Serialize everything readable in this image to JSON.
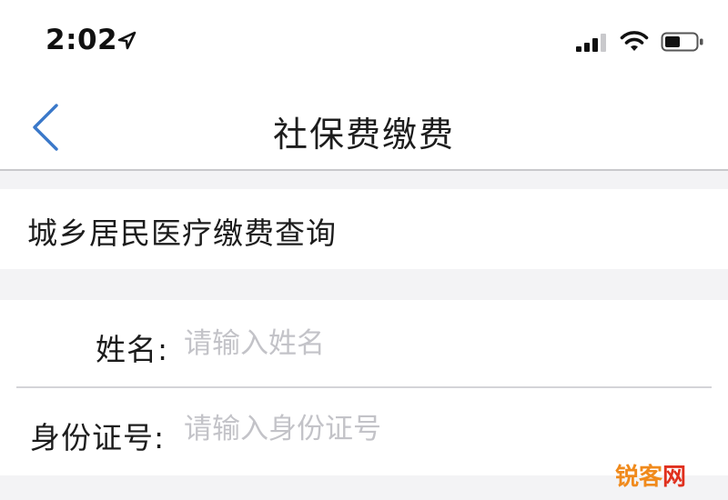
{
  "status_bar": {
    "time": "2:02",
    "icons": [
      "location-arrow-icon",
      "cellular-signal-icon",
      "wifi-icon",
      "battery-icon"
    ]
  },
  "nav": {
    "back_icon": "chevron-left-icon",
    "title": "社保费缴费",
    "accent_color": "#3a78c9"
  },
  "section": {
    "title": "城乡居民医疗缴费查询"
  },
  "form": {
    "name": {
      "label": "姓名:",
      "placeholder": "请输入姓名",
      "value": ""
    },
    "id_number": {
      "label": "身份证号:",
      "placeholder": "请输入身份证号",
      "value": ""
    }
  },
  "watermark": {
    "text_a": "锐客",
    "text_b": "网"
  }
}
